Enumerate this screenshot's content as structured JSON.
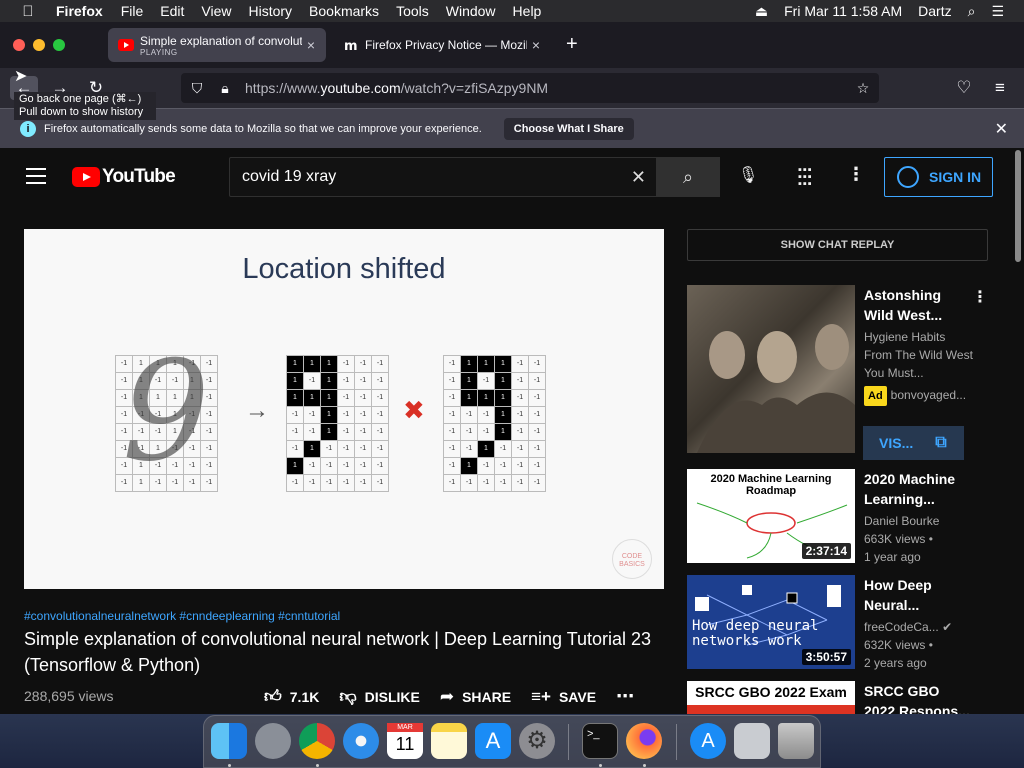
{
  "menubar": {
    "apple": "",
    "app": "Firefox",
    "items": [
      "File",
      "Edit",
      "View",
      "History",
      "Bookmarks",
      "Tools",
      "Window",
      "Help"
    ],
    "clock": "Fri Mar 11  1:58 AM",
    "user": "Dartz"
  },
  "tabs": [
    {
      "title": "Simple explanation of convolutio",
      "sub": "PLAYING",
      "favicon": "youtube-icon"
    },
    {
      "title": "Firefox Privacy Notice — Mozilla",
      "favicon": "mozilla-icon"
    }
  ],
  "navbar": {
    "url_prefix": "https://www.",
    "url_host": "youtube.com",
    "url_path": "/watch?v=zfiSAzpy9NM",
    "tooltip_line1": "Go back one page (⌘←)",
    "tooltip_line2": "Pull down to show history"
  },
  "notice": {
    "text": "Firefox automatically sends some data to Mozilla so that we can improve your experience.",
    "button": "Choose What I Share"
  },
  "youtube": {
    "logo_text": "YouTube",
    "search_value": "covid 19 xray",
    "sign_in": "SIGN IN"
  },
  "video": {
    "slide_title": "Location shifted",
    "grid_a": [
      "-1",
      "1",
      "1",
      "1",
      "-1",
      "-1",
      "-1",
      "1",
      "-1",
      "-1",
      "1",
      "-1",
      "-1",
      "1",
      "1",
      "1",
      "1",
      "-1",
      "-1",
      "-1",
      "-1",
      "1",
      "-1",
      "-1",
      "-1",
      "-1",
      "-1",
      "1",
      "-1",
      "-1",
      "-1",
      "-1",
      "1",
      "-1",
      "-1",
      "-1",
      "-1",
      "1",
      "-1",
      "-1",
      "-1",
      "-1",
      "-1",
      "1",
      "-1",
      "-1",
      "-1",
      "-1"
    ],
    "grid_b": [
      "1",
      "1",
      "1",
      "-1",
      "-1",
      "-1",
      "1",
      "-1",
      "1",
      "-1",
      "-1",
      "-1",
      "1",
      "1",
      "1",
      "-1",
      "-1",
      "-1",
      "-1",
      "-1",
      "1",
      "-1",
      "-1",
      "-1",
      "-1",
      "-1",
      "1",
      "-1",
      "-1",
      "-1",
      "-1",
      "1",
      "-1",
      "-1",
      "-1",
      "-1",
      "1",
      "-1",
      "-1",
      "-1",
      "-1",
      "-1",
      "-1",
      "-1",
      "-1",
      "-1",
      "-1",
      "-1"
    ],
    "grid_c": [
      "-1",
      "1",
      "1",
      "1",
      "-1",
      "-1",
      "-1",
      "1",
      "-1",
      "1",
      "-1",
      "-1",
      "-1",
      "1",
      "1",
      "1",
      "-1",
      "-1",
      "-1",
      "-1",
      "-1",
      "1",
      "-1",
      "-1",
      "-1",
      "-1",
      "-1",
      "1",
      "-1",
      "-1",
      "-1",
      "-1",
      "1",
      "-1",
      "-1",
      "-1",
      "-1",
      "1",
      "-1",
      "-1",
      "-1",
      "-1",
      "-1",
      "-1",
      "-1",
      "-1",
      "-1",
      "-1"
    ],
    "badge": "CODE BASICS",
    "hashtags": "#convolutionalneuralnetwork #cnndeeplearning #cnntutorial",
    "title": "Simple explanation of convolutional neural network | Deep Learning Tutorial 23 (Tensorflow & Python)",
    "views": "288,695 views",
    "likes": "7.1K",
    "dislike": "DISLIKE",
    "share": "SHARE",
    "save": "SAVE"
  },
  "sidebar": {
    "chat_replay": "SHOW CHAT REPLAY",
    "ad": {
      "title": "Astonshing Wild West...",
      "desc": "Hygiene Habits From The Wild West You Must...",
      "tag": "Ad",
      "channel": "bonvoyaged...",
      "visit": "VIS..."
    },
    "recs": [
      {
        "title": "2020 Machine Learning...",
        "channel": "Daniel Bourke",
        "views": "663K views •",
        "age": "1 year ago",
        "duration": "2:37:14",
        "thumb_text": "2020 Machine Learning Roadmap"
      },
      {
        "title": "How Deep Neural...",
        "channel": "freeCodeCa...",
        "views": "632K views •",
        "age": "2 years ago",
        "duration": "3:50:57",
        "thumb_text": "How deep neural networks work"
      },
      {
        "title": "SRCC GBO 2022 Respons...",
        "thumb_text": "SRCC GBO 2022 Exam"
      }
    ]
  },
  "colors": {
    "yt_red": "#ff0000",
    "link_blue": "#3ea6ff"
  }
}
